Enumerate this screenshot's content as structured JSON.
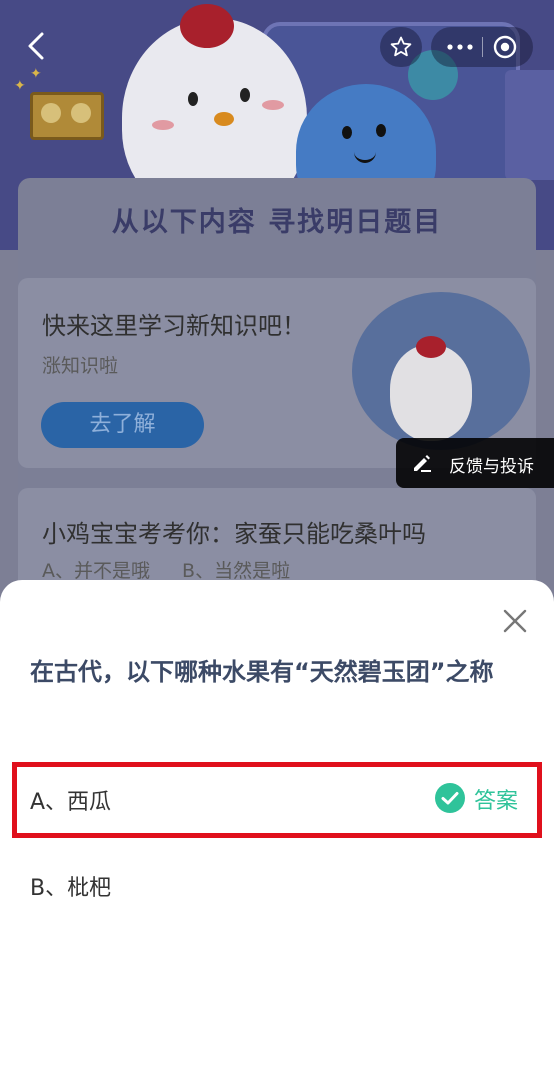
{
  "background": {
    "panel_title": "从以下内容  寻找明日题目",
    "card1": {
      "title": "快来这里学习新知识吧！",
      "subtitle": "涨知识啦",
      "button": "去了解"
    },
    "card2": {
      "title": "小鸡宝宝考考你：家蚕只能吃桑叶吗",
      "option_a": "A、并不是哦",
      "option_b": "B、当然是啦"
    },
    "feedback": "反馈与投诉"
  },
  "sheet": {
    "question": "在古代，以下哪种水果有“天然碧玉团”之称",
    "options": [
      {
        "label": "A、西瓜",
        "is_answer": true
      },
      {
        "label": "B、枇杷",
        "is_answer": false
      }
    ],
    "answer_badge": "答案"
  },
  "colors": {
    "answer_green": "#2fc39a",
    "highlight_red": "#e0101c",
    "question_text": "#3c4a66"
  },
  "icons": [
    "back-icon",
    "star-icon",
    "more-icon",
    "target-icon",
    "edit-icon",
    "close-icon",
    "check-circle-icon"
  ]
}
